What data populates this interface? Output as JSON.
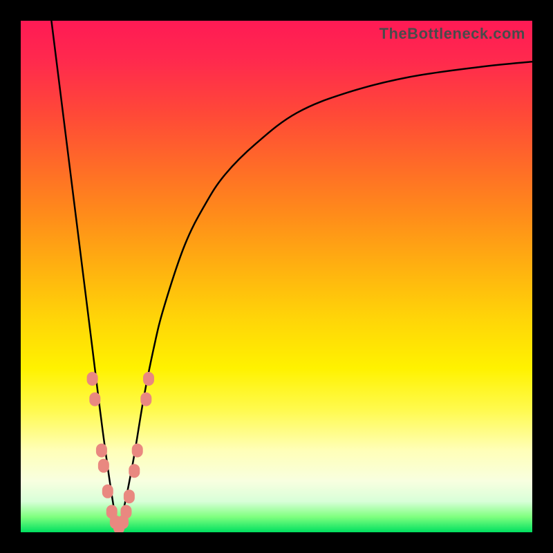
{
  "watermark": "TheBottleneck.com",
  "chart_data": {
    "type": "line",
    "title": "",
    "xlabel": "",
    "ylabel": "",
    "xlim": [
      0,
      100
    ],
    "ylim": [
      0,
      100
    ],
    "grid": false,
    "legend": false,
    "background": "gradient-red-to-green-vertical",
    "series": [
      {
        "name": "bottleneck-curve",
        "description": "V-shaped curve with minimum near x≈19; left branch steep, right branch asymptotic",
        "x": [
          6,
          8,
          10,
          12,
          14,
          16,
          18,
          19,
          20,
          22,
          24,
          26,
          28,
          32,
          36,
          40,
          46,
          54,
          64,
          76,
          90,
          100
        ],
        "y": [
          100,
          84,
          68,
          52,
          36,
          20,
          6,
          1,
          4,
          14,
          26,
          36,
          44,
          56,
          64,
          70,
          76,
          82,
          86,
          89,
          91,
          92
        ]
      }
    ],
    "markers": {
      "name": "highlight-points",
      "color": "#e98880",
      "shape": "rounded-rect",
      "points": [
        {
          "x": 14.0,
          "y": 30
        },
        {
          "x": 14.5,
          "y": 26
        },
        {
          "x": 15.8,
          "y": 16
        },
        {
          "x": 16.2,
          "y": 13
        },
        {
          "x": 17.0,
          "y": 8
        },
        {
          "x": 17.8,
          "y": 4
        },
        {
          "x": 18.5,
          "y": 2
        },
        {
          "x": 19.2,
          "y": 1
        },
        {
          "x": 20.0,
          "y": 2
        },
        {
          "x": 20.6,
          "y": 4
        },
        {
          "x": 21.2,
          "y": 7
        },
        {
          "x": 22.2,
          "y": 12
        },
        {
          "x": 22.8,
          "y": 16
        },
        {
          "x": 24.5,
          "y": 26
        },
        {
          "x": 25.0,
          "y": 30
        }
      ]
    }
  }
}
